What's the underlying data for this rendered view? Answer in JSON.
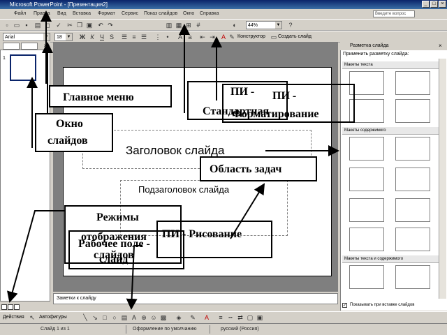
{
  "window": {
    "title": "Microsoft PowerPoint - [Презентация2]",
    "controls": [
      "_",
      "□",
      "×"
    ]
  },
  "menu": {
    "items": [
      "Файл",
      "Правка",
      "Вид",
      "Вставка",
      "Формат",
      "Сервис",
      "Показ слайдов",
      "Окно",
      "Справка"
    ],
    "help_placeholder": "Введите вопрос"
  },
  "toolbar_standard": {
    "zoom": "44%"
  },
  "toolbar_format": {
    "font": "Arial",
    "size": "18",
    "bold": "Ж",
    "italic": "К",
    "underline": "Ч",
    "shadow": "S",
    "designer": "Конструктор",
    "new_slide": "Создать слайд"
  },
  "slide_pane": {
    "thumb_number": "1"
  },
  "slide": {
    "title_placeholder": "Заголовок слайда",
    "subtitle_placeholder": "Подзаголовок слайда"
  },
  "notes": {
    "placeholder": "Заметки к слайду"
  },
  "task_pane": {
    "header": "Разметка слайда",
    "subtitle": "Применить разметку слайда:",
    "sections": [
      "Макеты текста",
      "Макеты содержимого",
      "Макеты текста и содержимого"
    ],
    "show_checkbox_label": "Показывать при вставке слайдов"
  },
  "drawing": {
    "actions": "Действия",
    "autoshapes": "Автофигуры"
  },
  "status": {
    "slide": "Слайд 1 из 1",
    "design": "Оформление по умолчанию",
    "language": "русский (Россия)"
  },
  "callouts": {
    "main_menu": "Главное меню",
    "pi_standard_1": "ПИ -",
    "pi_standard_2": "Стандартная",
    "pi_format_1": "ПИ -",
    "pi_format_2": "Форматирование",
    "slides_window_1": "Окно",
    "slides_window_2": "слайдов",
    "task_area": "Область задач",
    "view_modes_1": "Режимы",
    "view_modes_2": "отображения",
    "view_modes_3": "слайдов",
    "pi_drawing": "ПИ - Рисование",
    "workspace_1": "Рабочее поле -",
    "workspace_2": "слайд"
  }
}
